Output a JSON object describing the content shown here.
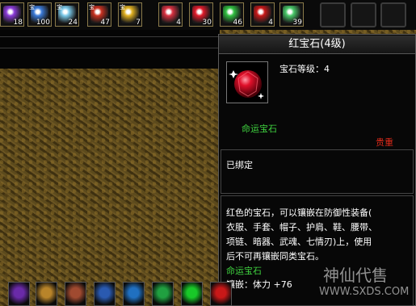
{
  "itembar": {
    "items": [
      {
        "icon": "purple-crystal-icon",
        "color": "#8a3ad8",
        "count": "18",
        "tag": ""
      },
      {
        "icon": "blue-crystal-icon",
        "color": "#3a7ad8",
        "count": "100",
        "tag": "宝"
      },
      {
        "icon": "ice-crystal-icon",
        "color": "#7ac8e8",
        "count": "24",
        "tag": "宝"
      },
      {
        "icon": "red-crystal-icon",
        "color": "#c83020",
        "count": "47",
        "tag": "宝"
      },
      {
        "icon": "gold-crystal-icon",
        "color": "#e0b020",
        "count": "7",
        "tag": "宝"
      },
      {
        "icon": "red-gem-icon",
        "color": "#d83040",
        "count": "4",
        "tag": ""
      },
      {
        "icon": "red-gem-icon",
        "color": "#e01a2a",
        "count": "30",
        "tag": ""
      },
      {
        "icon": "green-gem-icon",
        "color": "#30c040",
        "count": "46",
        "tag": ""
      },
      {
        "icon": "red-gem-icon",
        "color": "#c81818",
        "count": "4",
        "tag": ""
      },
      {
        "icon": "jade-ring-icon",
        "color": "#48c868",
        "count": "39",
        "tag": ""
      }
    ]
  },
  "tooltip": {
    "title": "红宝石(4级)",
    "level_text": "宝石等级：4",
    "fate_label": "命运宝石",
    "rarity": "贵重",
    "bound": "已绑定",
    "description": [
      "红色的宝石，可以镶嵌在防御性装备(",
      "衣服、手套、帽子、护肩、鞋、腰带、",
      "项链、暗器、武魂、七情刃)上，使用",
      "后不可再镶嵌同类宝石。"
    ],
    "fate_label2": "命运宝石",
    "inlay": "镶嵌：体力 +76"
  },
  "skills": [
    {
      "icon": "purple-slash-icon",
      "color": "#6a2aa8"
    },
    {
      "icon": "horse-icon",
      "color": "#b8842a"
    },
    {
      "icon": "warrior-portrait-icon",
      "color": "#a04a30"
    },
    {
      "icon": "blue-figure-icon",
      "color": "#2a5ab0"
    },
    {
      "icon": "blue-swirl-icon",
      "color": "#2070c0"
    },
    {
      "icon": "green-swirl-icon",
      "color": "#20a040"
    },
    {
      "icon": "green-ring-icon",
      "color": "#18c828"
    },
    {
      "icon": "red-gem-icon",
      "color": "#c81818"
    }
  ],
  "watermark": {
    "logo": "神仙代售",
    "url": "WWW.SXDS.COM"
  }
}
